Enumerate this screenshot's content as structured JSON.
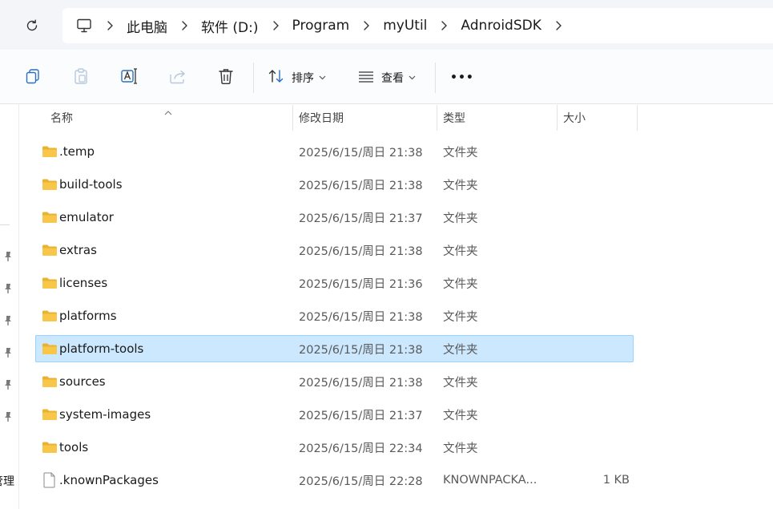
{
  "breadcrumb": {
    "items": [
      "此电脑",
      "软件 (D:)",
      "Program",
      "myUtil",
      "AdnroidSDK"
    ]
  },
  "toolbar": {
    "sort_label": "排序",
    "view_label": "查看",
    "more_label": "•••"
  },
  "columns": {
    "name": "名称",
    "modified": "修改日期",
    "type": "类型",
    "size": "大小"
  },
  "files": [
    {
      "name": ".temp",
      "modified": "2025/6/15/周日 21:38",
      "type": "文件夹",
      "size": "",
      "kind": "folder"
    },
    {
      "name": "build-tools",
      "modified": "2025/6/15/周日 21:38",
      "type": "文件夹",
      "size": "",
      "kind": "folder"
    },
    {
      "name": "emulator",
      "modified": "2025/6/15/周日 21:37",
      "type": "文件夹",
      "size": "",
      "kind": "folder"
    },
    {
      "name": "extras",
      "modified": "2025/6/15/周日 21:38",
      "type": "文件夹",
      "size": "",
      "kind": "folder"
    },
    {
      "name": "licenses",
      "modified": "2025/6/15/周日 21:36",
      "type": "文件夹",
      "size": "",
      "kind": "folder"
    },
    {
      "name": "platforms",
      "modified": "2025/6/15/周日 21:38",
      "type": "文件夹",
      "size": "",
      "kind": "folder"
    },
    {
      "name": "platform-tools",
      "modified": "2025/6/15/周日 21:38",
      "type": "文件夹",
      "size": "",
      "kind": "folder",
      "selected": true
    },
    {
      "name": "sources",
      "modified": "2025/6/15/周日 21:38",
      "type": "文件夹",
      "size": "",
      "kind": "folder"
    },
    {
      "name": "system-images",
      "modified": "2025/6/15/周日 21:37",
      "type": "文件夹",
      "size": "",
      "kind": "folder"
    },
    {
      "name": "tools",
      "modified": "2025/6/15/周日 22:34",
      "type": "文件夹",
      "size": "",
      "kind": "folder"
    },
    {
      "name": ".knownPackages",
      "modified": "2025/6/15/周日 22:28",
      "type": "KNOWNPACKA...",
      "size": "1 KB",
      "kind": "file"
    }
  ],
  "nav": {
    "partial_label": "管理"
  },
  "colors": {
    "selection_bg": "#cce8ff",
    "selection_border": "#99d1ff",
    "folder": "#f8c648"
  }
}
